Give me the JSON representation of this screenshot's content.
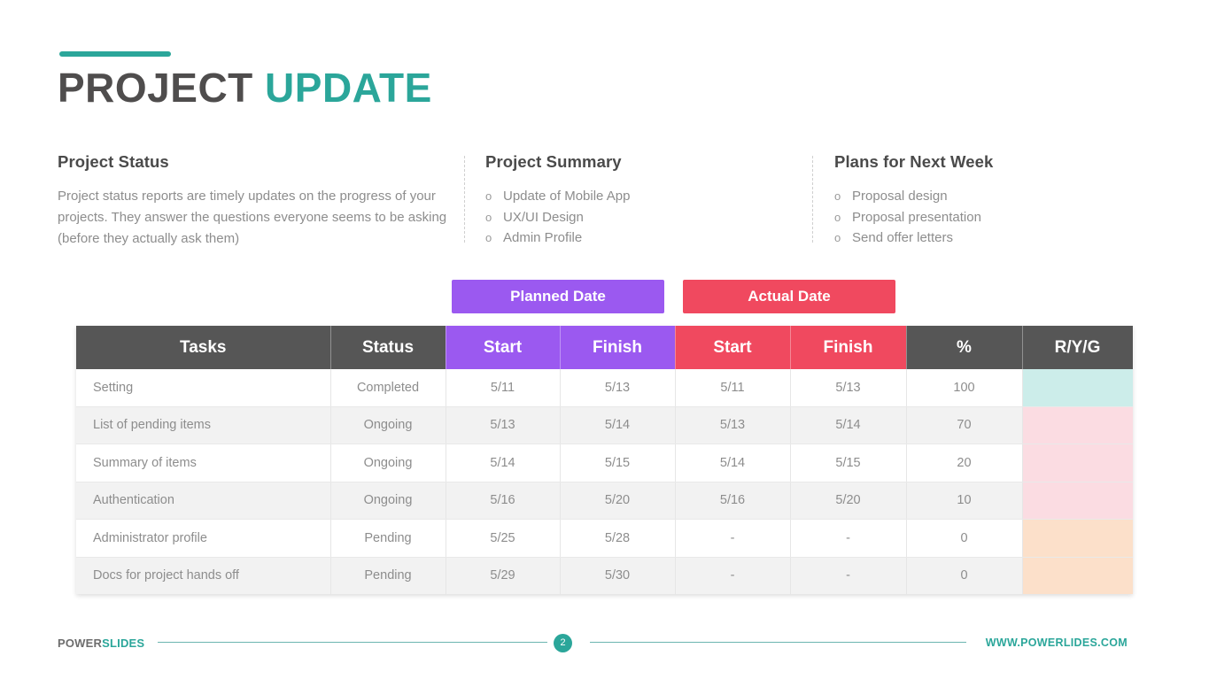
{
  "title": {
    "primary": "PROJECT ",
    "accent": "UPDATE",
    "accent_color": "#2ba69a"
  },
  "columns": {
    "status": {
      "heading": "Project Status",
      "body": "Project status reports are timely updates on the progress of your projects. They answer the questions everyone seems to be asking (before they actually ask them)"
    },
    "summary": {
      "heading": "Project Summary",
      "marker": "o",
      "items": [
        "Update of Mobile App",
        "UX/UI Design",
        "Admin Profile"
      ]
    },
    "plans": {
      "heading": "Plans for Next Week",
      "marker": "o",
      "items": [
        "Proposal design",
        "Proposal presentation",
        "Send offer letters"
      ]
    }
  },
  "legend": {
    "planned": {
      "label": "Planned Date",
      "color": "#9b59f0"
    },
    "actual": {
      "label": "Actual Date",
      "color": "#f0495f"
    }
  },
  "table": {
    "header_dark_color": "#565656",
    "headers": [
      "Tasks",
      "Status",
      "Start",
      "Finish",
      "Start",
      "Finish",
      "%",
      "R/Y/G"
    ],
    "rows": [
      {
        "task": "Setting",
        "status": "Completed",
        "planned_start": "5/11",
        "planned_finish": "5/13",
        "actual_start": "5/11",
        "actual_finish": "5/13",
        "percent": "100",
        "ryg_color": "#ccedea"
      },
      {
        "task": "List of pending items",
        "status": "Ongoing",
        "planned_start": "5/13",
        "planned_finish": "5/14",
        "actual_start": "5/13",
        "actual_finish": "5/14",
        "percent": "70",
        "ryg_color": "#fbdce2"
      },
      {
        "task": "Summary of items",
        "status": "Ongoing",
        "planned_start": "5/14",
        "planned_finish": "5/15",
        "actual_start": "5/14",
        "actual_finish": "5/15",
        "percent": "20",
        "ryg_color": "#fbdce2"
      },
      {
        "task": "Authentication",
        "status": "Ongoing",
        "planned_start": "5/16",
        "planned_finish": "5/20",
        "actual_start": "5/16",
        "actual_finish": "5/20",
        "percent": "10",
        "ryg_color": "#fbdce2"
      },
      {
        "task": "Administrator profile",
        "status": "Pending",
        "planned_start": "5/25",
        "planned_finish": "5/28",
        "actual_start": "-",
        "actual_finish": "-",
        "percent": "0",
        "ryg_color": "#fce0ca"
      },
      {
        "task": "Docs for project hands off",
        "status": "Pending",
        "planned_start": "5/29",
        "planned_finish": "5/30",
        "actual_start": "-",
        "actual_finish": "-",
        "percent": "0",
        "ryg_color": "#fce0ca"
      }
    ]
  },
  "footer": {
    "brand_first": "POWER",
    "brand_second": "SLIDES",
    "page_number": "2",
    "url": "WWW.POWERLIDES.COM"
  }
}
